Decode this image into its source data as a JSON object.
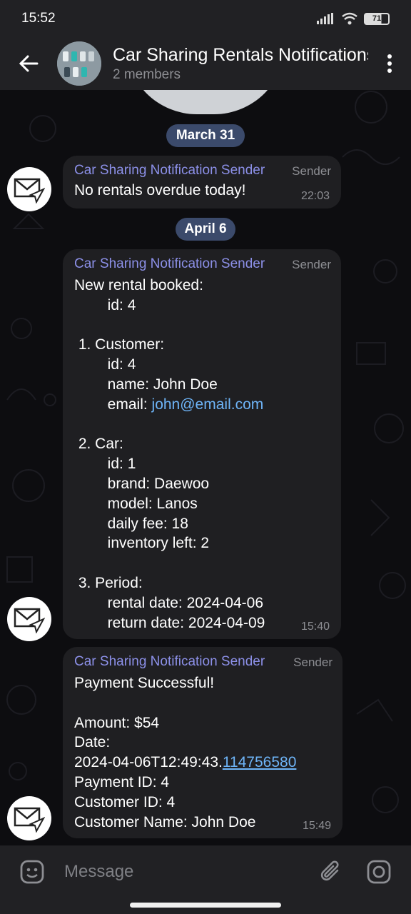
{
  "status_bar": {
    "time": "15:52",
    "battery": "71"
  },
  "header": {
    "title": "Car Sharing Rentals Notifications",
    "subtitle": "2 members"
  },
  "dates": {
    "d1": "March 31",
    "d2": "April 6"
  },
  "messages": [
    {
      "sender": "Car Sharing Notification Sender",
      "role": "Sender",
      "body": "No rentals overdue today!",
      "time": "22:03"
    },
    {
      "sender": "Car Sharing Notification Sender",
      "role": "Sender",
      "lines": {
        "l1": "New rental booked:",
        "l2": "        id: 4",
        "l3": "",
        "l4": " 1. Customer:",
        "l5": "        id: 4",
        "l6": "        name: John Doe",
        "l7_prefix": "        email: ",
        "l7_link": "john@email.com",
        "l8": "",
        "l9": " 2. Car:",
        "l10": "        id: 1",
        "l11": "        brand: Daewoo",
        "l12": "        model: Lanos",
        "l13": "        daily fee: 18",
        "l14": "        inventory left: 2",
        "l15": "",
        "l16": " 3. Period:",
        "l17": "        rental date: 2024-04-06",
        "l18": "        return date: 2024-04-09"
      },
      "time": "15:40"
    },
    {
      "sender": "Car Sharing Notification Sender",
      "role": "Sender",
      "lines": {
        "l1": "Payment Successful!",
        "l2": "",
        "l3": "Amount: $54",
        "l4": "Date:",
        "l5_prefix": "2024-04-06T12:49:43.",
        "l5_link": "114756580",
        "l6": "Payment ID: 4",
        "l7": "Customer ID: 4",
        "l8": "Customer Name: John Doe"
      },
      "time": "15:49"
    }
  ],
  "composer": {
    "placeholder": "Message"
  },
  "colors": {
    "accent_name": "#8c90e8",
    "link": "#6eb4f7",
    "date_pill": "#3b4a6b",
    "bubble": "#1f1f22",
    "bar": "#212124"
  },
  "icons": [
    "back-arrow-icon",
    "more-vert-icon",
    "envelope-send-icon",
    "sticker-icon",
    "attach-icon",
    "camera-icon",
    "signal-icon",
    "wifi-icon",
    "battery-icon"
  ]
}
